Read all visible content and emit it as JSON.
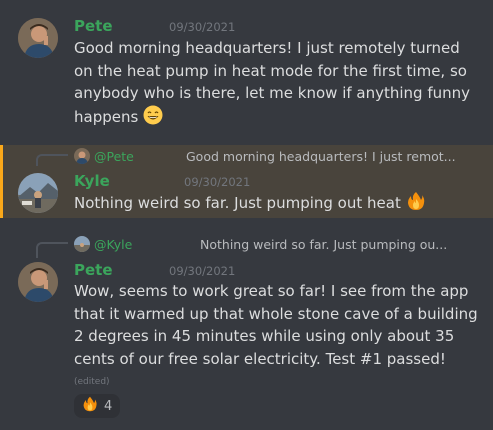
{
  "messages": [
    {
      "author": "Pete",
      "timestamp": "09/30/2021",
      "lines": [
        "Good morning headquarters! I just remotely turned",
        "on the heat pump in heat mode for the first time, so",
        "anybody who is there, let me know if anything funny",
        "happens"
      ],
      "emoji": "😄"
    },
    {
      "reply": {
        "name": "@Pete",
        "text": "Good morning headquarters! I just remot..."
      },
      "author": "Kyle",
      "timestamp": "09/30/2021",
      "text": "Nothing weird so far.  Just pumping out heat",
      "emoji": "🔥",
      "highlighted": true
    },
    {
      "reply": {
        "name": "@Kyle",
        "text": "Nothing weird so far.  Just pumping ou..."
      },
      "author": "Pete",
      "timestamp": "09/30/2021",
      "lines": [
        "Wow, seems to work great so far! I see from the app",
        "that it warmed up that whole stone cave of a building",
        "2 degrees in 45 minutes while using only about 35",
        "cents of our free solar electricity. Test #1 passed!"
      ],
      "edited": "(edited)",
      "reaction": {
        "emoji": "🔥",
        "count": "4"
      }
    }
  ],
  "colors": {
    "background": "#36393f",
    "author": "#3ba55c",
    "highlight_bg": "#49443c",
    "highlight_border": "#faa81a",
    "timestamp": "#72767d"
  }
}
